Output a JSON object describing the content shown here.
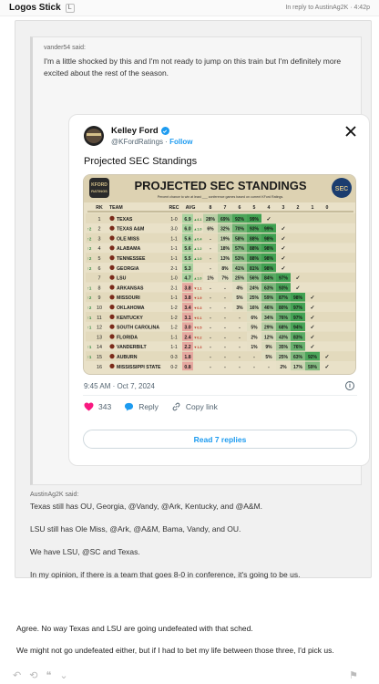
{
  "topbar": {
    "username": "Logos Stick",
    "badge": "L",
    "reply_meta": "In reply to AustinAg2K · 4:42p"
  },
  "quote1": {
    "author": "vander54 said:",
    "text": "I'm a little shocked by this and I'm not ready to jump on this train but I'm definitely more excited about the rest of the season."
  },
  "tweet": {
    "name": "Kelley Ford",
    "handle": "@KFordRatings",
    "follow": "Follow",
    "title": "Projected SEC Standings",
    "date": "9:45 AM · Oct 7, 2024",
    "likes": "343",
    "reply_label": "Reply",
    "copy_label": "Copy link",
    "read_label": "Read 7 replies"
  },
  "image": {
    "logo_text": "KFORD RATINGS",
    "title": "PROJECTED SEC STANDINGS",
    "subtitle": "Percent chance to win at least ___ conference games based on current KFord Ratings.",
    "sec_logo": "SEC",
    "headers": [
      "RK",
      "TEAM",
      "REC",
      "AVG",
      "8",
      "7",
      "6",
      "5",
      "4",
      "3",
      "2",
      "1",
      "0"
    ],
    "rows": [
      {
        "chg": "",
        "rk": "1",
        "team": "TEXAS",
        "rec": "1-0",
        "avg": "6.9",
        "d": "4.1",
        "c": [
          "28%",
          "69%",
          "92%",
          "99%",
          "",
          "",
          "",
          "",
          ""
        ]
      },
      {
        "chg": "2",
        "rk": "2",
        "team": "TEXAS A&M",
        "rec": "3-0",
        "avg": "6.0",
        "d": "1.0",
        "c": [
          "6%",
          "32%",
          "70%",
          "93%",
          "99%",
          "",
          "",
          "",
          ""
        ]
      },
      {
        "chg": "2",
        "rk": "3",
        "team": "OLE MISS",
        "rec": "1-1",
        "avg": "5.6",
        "d": "0.4",
        "c": [
          "-",
          "19%",
          "58%",
          "88%",
          "98%",
          "",
          "",
          "",
          ""
        ]
      },
      {
        "chg": "2",
        "rk": "4",
        "team": "ALABAMA",
        "rec": "1-1",
        "avg": "5.6",
        "d": "1.2",
        "c": [
          "-",
          "18%",
          "57%",
          "88%",
          "98%",
          "",
          "",
          "",
          ""
        ]
      },
      {
        "chg": "2",
        "rk": "5",
        "team": "TENNESSEE",
        "rec": "1-1",
        "avg": "5.5",
        "d": "1.0",
        "c": [
          "-",
          "13%",
          "53%",
          "88%",
          "98%",
          "",
          "",
          "",
          ""
        ]
      },
      {
        "chg": "2",
        "rk": "6",
        "team": "GEORGIA",
        "rec": "2-1",
        "avg": "5.3",
        "d": "",
        "c": [
          "-",
          "8%",
          "41%",
          "81%",
          "98%",
          "",
          "",
          "",
          ""
        ]
      },
      {
        "chg": "",
        "rk": "7",
        "team": "LSU",
        "rec": "1-0",
        "avg": "4.7",
        "d": "1.0",
        "c": [
          "1%",
          "7%",
          "25%",
          "56%",
          "84%",
          "97%",
          "",
          "",
          ""
        ]
      },
      {
        "chg": "1",
        "rk": "8",
        "team": "ARKANSAS",
        "rec": "2-1",
        "avg": "3.8",
        "d": "1.1",
        "c": [
          "-",
          "-",
          "4%",
          "24%",
          "63%",
          "93%",
          "",
          "",
          ""
        ]
      },
      {
        "chg": "2",
        "rk": "9",
        "team": "MISSOURI",
        "rec": "1-1",
        "avg": "3.8",
        "d": "1.9",
        "c": [
          "-",
          "-",
          "5%",
          "25%",
          "59%",
          "87%",
          "98%",
          "",
          ""
        ]
      },
      {
        "chg": "2",
        "rk": "10",
        "team": "OKLAHOMA",
        "rec": "1-2",
        "avg": "3.4",
        "d": "0.3",
        "c": [
          "-",
          "-",
          "3%",
          "16%",
          "46%",
          "80%",
          "97%",
          "",
          ""
        ]
      },
      {
        "chg": "1",
        "rk": "11",
        "team": "KENTUCKY",
        "rec": "1-2",
        "avg": "3.1",
        "d": "0.1",
        "c": [
          "-",
          "-",
          "-",
          "6%",
          "34%",
          "76%",
          "97%",
          "",
          ""
        ]
      },
      {
        "chg": "1",
        "rk": "12",
        "team": "SOUTH CAROLINA",
        "rec": "1-2",
        "avg": "3.0",
        "d": "0.5",
        "c": [
          "-",
          "-",
          "-",
          "5%",
          "29%",
          "68%",
          "94%",
          "",
          ""
        ]
      },
      {
        "chg": "",
        "rk": "13",
        "team": "FLORIDA",
        "rec": "1-1",
        "avg": "2.4",
        "d": "0.2",
        "c": [
          "-",
          "-",
          "-",
          "2%",
          "12%",
          "43%",
          "83%",
          "",
          ""
        ]
      },
      {
        "chg": "1",
        "rk": "14",
        "team": "VANDERBILT",
        "rec": "1-1",
        "avg": "2.2",
        "d": "1.3",
        "c": [
          "-",
          "-",
          "-",
          "1%",
          "9%",
          "35%",
          "76%",
          "",
          ""
        ]
      },
      {
        "chg": "1",
        "rk": "15",
        "team": "AUBURN",
        "rec": "0-3",
        "avg": "1.8",
        "d": "",
        "c": [
          "-",
          "-",
          "-",
          "-",
          "5%",
          "25%",
          "63%",
          "92%",
          ""
        ]
      },
      {
        "chg": "",
        "rk": "16",
        "team": "MISSISSIPPI STATE",
        "rec": "0-2",
        "avg": "0.8",
        "d": "",
        "c": [
          "-",
          "-",
          "-",
          "-",
          "-",
          "2%",
          "17%",
          "59%",
          ""
        ]
      }
    ]
  },
  "quote2": {
    "author": "AustinAg2K said:",
    "lines": [
      "Texas still has OU, Georgia, @Vandy, @Ark, Kentucky, and @A&M.",
      "LSU still has Ole Miss, @Ark, @A&M, Bama, Vandy, and OU.",
      "We have LSU, @SC and Texas.",
      "In my opinion, if there is a team that goes 8-0 in conference, it's going to be us."
    ]
  },
  "reply": {
    "lines": [
      "Agree. No way Texas and LSU are going undefeated with that sched.",
      "We might not go undefeated either, but if I had to bet my life between those three, I'd pick us."
    ]
  },
  "colors": {
    "twitter_blue": "#1d9bf0",
    "heart": "#f91880",
    "chart_green": "#5fb86a",
    "chart_red": "#d9534f",
    "chart_gold": "#d4c08a"
  }
}
